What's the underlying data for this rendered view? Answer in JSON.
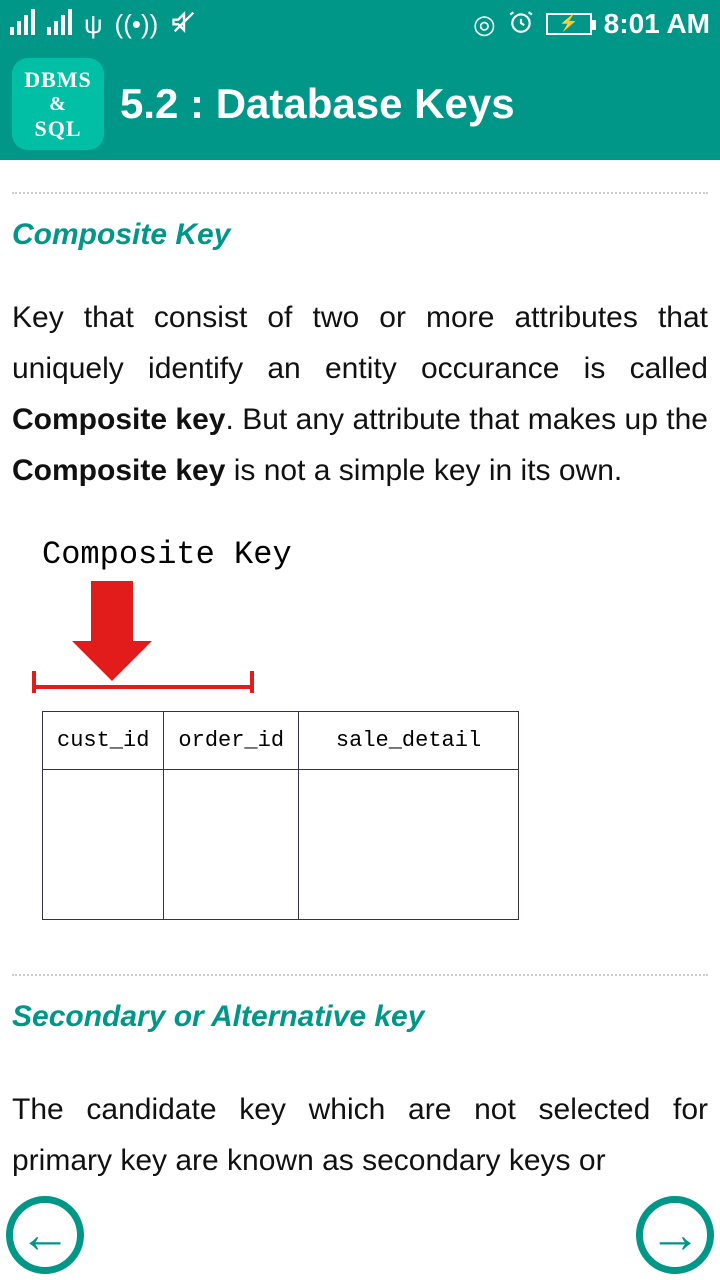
{
  "status": {
    "time": "8:01 AM",
    "battery_glyph": "⚡"
  },
  "app": {
    "icon_l1": "DBMS",
    "icon_l2": "&",
    "icon_l3": "SQL",
    "title": "5.2 : Database Keys"
  },
  "section1": {
    "heading": "Composite Key",
    "p1a": "Key that consist of two or more attributes that uniquely identify an entity occurance is called ",
    "p1b": "Composite key",
    "p1c": ". But any attribute that makes up the ",
    "p1d": "Composite key",
    "p1e": " is not a simple key in its own."
  },
  "figure": {
    "title": "Composite Key",
    "cols": [
      "cust_id",
      "order_id",
      "sale_detail"
    ]
  },
  "section2": {
    "heading": "Secondary or Alternative key",
    "p": "The candidate key which are not selected for primary key are known as secondary keys or"
  }
}
